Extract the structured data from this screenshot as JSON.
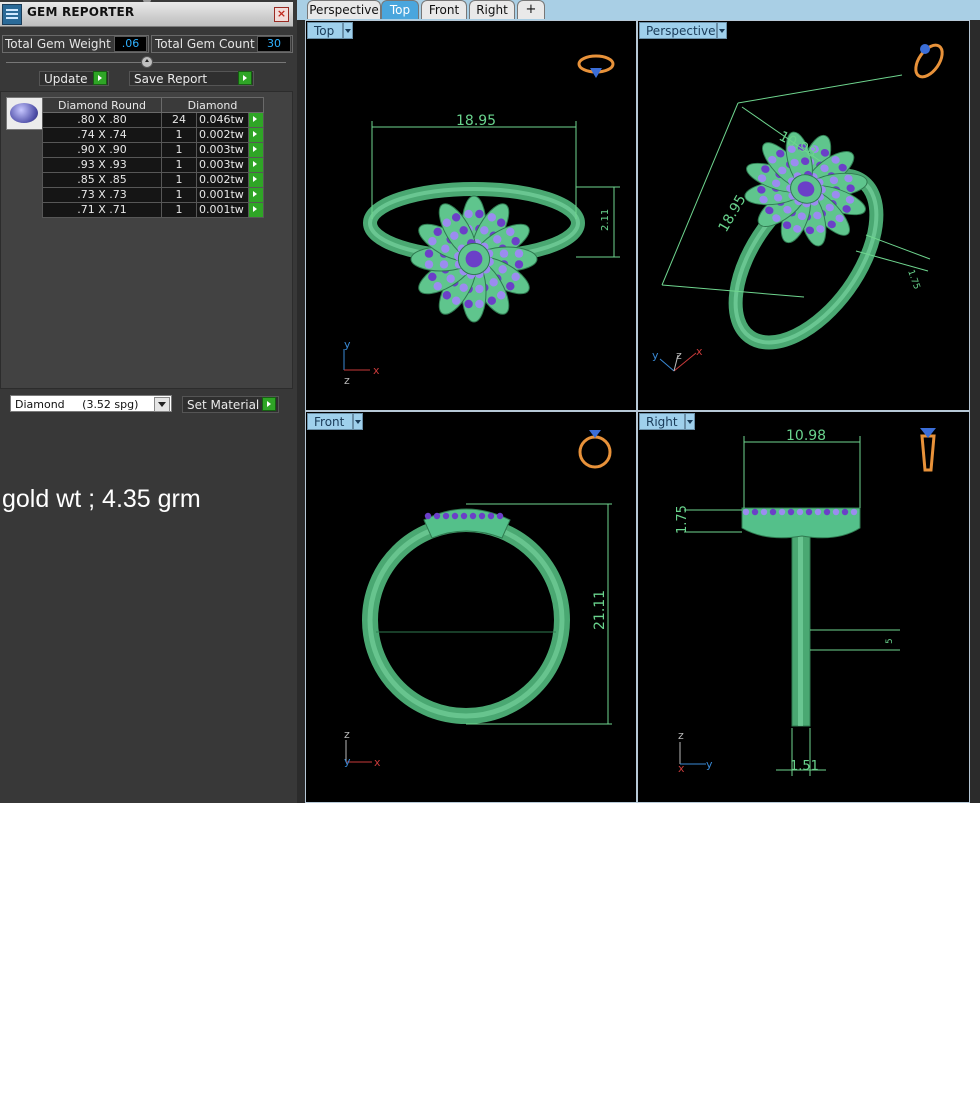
{
  "panel": {
    "title": "GEM REPORTER",
    "total_weight_label": "Total Gem Weight",
    "total_weight_value": ".06",
    "total_count_label": "Total Gem Count",
    "total_count_value": "30",
    "update_label": "Update",
    "save_report_label": "Save Report",
    "table": {
      "headers": [
        "Diamond Round",
        "Diamond"
      ],
      "rows": [
        {
          "size": ".80 X .80",
          "count": "24",
          "weight": "0.046tw"
        },
        {
          "size": ".74 X .74",
          "count": "1",
          "weight": "0.002tw"
        },
        {
          "size": ".90 X .90",
          "count": "1",
          "weight": "0.003tw"
        },
        {
          "size": ".93 X .93",
          "count": "1",
          "weight": "0.003tw"
        },
        {
          "size": ".85 X .85",
          "count": "1",
          "weight": "0.002tw"
        },
        {
          "size": ".73 X .73",
          "count": "1",
          "weight": "0.001tw"
        },
        {
          "size": ".71 X .71",
          "count": "1",
          "weight": "0.001tw"
        }
      ]
    },
    "material_select": "Diamond     (3.52 spg)",
    "set_material_label": "Set Material",
    "note": "gold wt ; 4.35 grm"
  },
  "tabs": [
    "Perspective",
    "Top",
    "Front",
    "Right",
    "+"
  ],
  "active_tab": "Top",
  "viewports": {
    "top": {
      "label": "Top",
      "dims": [
        "18.95",
        "2.11"
      ],
      "axes": [
        "y",
        "z",
        "x"
      ]
    },
    "perspective": {
      "label": "Perspective",
      "dims": [
        "10.98",
        "18.95",
        "1.75"
      ],
      "axes": [
        "y",
        "z",
        "x"
      ]
    },
    "front": {
      "label": "Front",
      "dims": [
        "21.11"
      ],
      "axes": [
        "z",
        "y",
        "x"
      ]
    },
    "right": {
      "label": "Right",
      "dims": [
        "10.98",
        "1.75",
        "1.51",
        "5"
      ],
      "axes": [
        "z",
        "x",
        "y"
      ]
    }
  },
  "colors": {
    "metal": "#5fc58d",
    "gem": "#6b3fc8",
    "dimension": "#6fd68f",
    "tab_active": "#4aa6dd",
    "label_bg": "#9fd0ec"
  }
}
